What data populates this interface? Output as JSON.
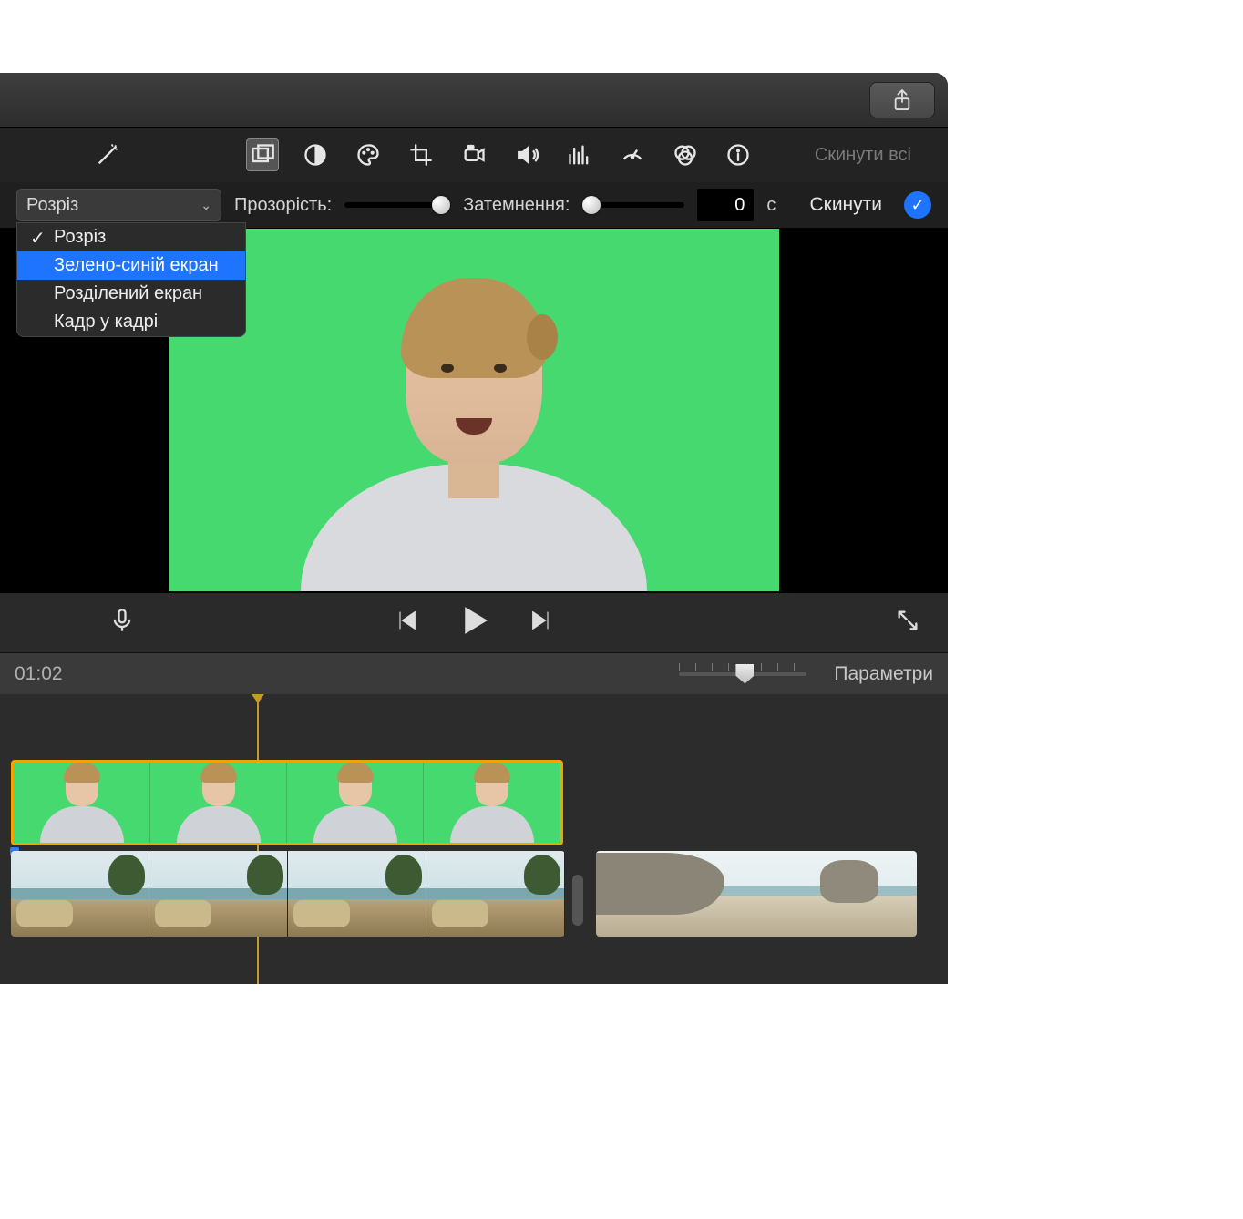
{
  "titlebar": {
    "share_icon": "share-icon"
  },
  "adjust_bar": {
    "reset_all": "Скинути всі",
    "tools": [
      {
        "name": "wand-icon"
      },
      {
        "name": "overlay-icon",
        "active": true
      },
      {
        "name": "contrast-icon"
      },
      {
        "name": "palette-icon"
      },
      {
        "name": "crop-icon"
      },
      {
        "name": "camera-icon"
      },
      {
        "name": "volume-icon"
      },
      {
        "name": "equalizer-icon"
      },
      {
        "name": "speed-icon"
      },
      {
        "name": "color-filter-icon"
      },
      {
        "name": "info-icon"
      }
    ]
  },
  "overlay_row": {
    "select_value": "Розріз",
    "menu": [
      {
        "label": "Розріз",
        "checked": true
      },
      {
        "label": "Зелено-синій екран",
        "hover": true
      },
      {
        "label": "Розділений екран"
      },
      {
        "label": "Кадр у кадрі"
      }
    ],
    "opacity_label": "Прозорість:",
    "dim_label": "Затемнення:",
    "duration_value": "0",
    "duration_unit": "с",
    "reset_label": "Скинути"
  },
  "playbar": {
    "mic_icon": "microphone-icon",
    "prev_icon": "skip-back-icon",
    "play_icon": "play-icon",
    "next_icon": "skip-forward-icon",
    "expand_icon": "expand-icon"
  },
  "timeline_header": {
    "timecode": "01:02",
    "params_label": "Параметри"
  }
}
